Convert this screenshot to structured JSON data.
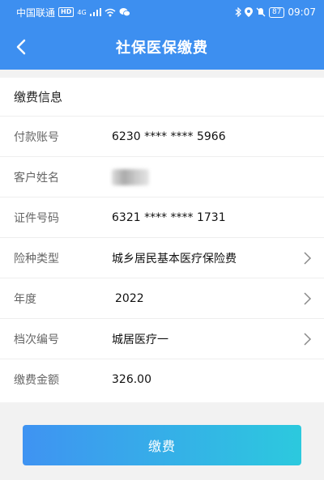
{
  "status_bar": {
    "carrier": "中国联通",
    "hd": "HD",
    "network": "4G",
    "battery": "87",
    "time": "09:07",
    "icons": [
      "signal-icon",
      "wifi-icon",
      "wechat-icon",
      "bluetooth-icon",
      "location-icon",
      "mute-icon",
      "battery-icon"
    ]
  },
  "header": {
    "title": "社保医保缴费",
    "back_icon": "chevron-left-icon"
  },
  "form": {
    "section_title": "缴费信息",
    "rows": [
      {
        "label": "付款账号",
        "value": "6230 **** **** 5966"
      },
      {
        "label": "客户姓名",
        "value": ""
      },
      {
        "label": "证件号码",
        "value": "6321 **** **** 1731"
      },
      {
        "label": "险种类型",
        "value": "城乡居民基本医疗保险费"
      },
      {
        "label": "年度",
        "value": "2022"
      },
      {
        "label": "档次编号",
        "value": "城居医疗一"
      },
      {
        "label": "缴费金额",
        "value": "326.00"
      }
    ]
  },
  "actions": {
    "pay_label": "缴费"
  },
  "colors": {
    "header_bg": "#3d8ff0",
    "button_gradient_start": "#3f93f2",
    "button_gradient_end": "#2cc9de"
  }
}
